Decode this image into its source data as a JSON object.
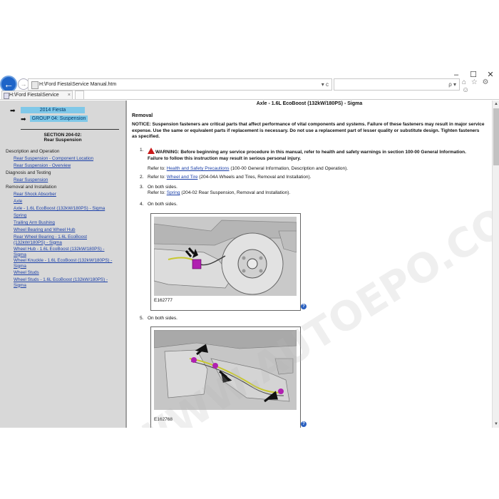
{
  "window": {
    "min": "–",
    "max": "☐",
    "close": "✕"
  },
  "address": {
    "url": "H:\\Ford Fiesta\\Service Manual.htm",
    "tools": "▾ c"
  },
  "search": {
    "tools": "ρ ▾"
  },
  "right_icons": "⌂ ☆ ⚙ ☺",
  "tab": {
    "label": "H:\\Ford Fiesta\\Service Man...",
    "close": "×"
  },
  "sidebar": {
    "year_pill": "2014 Fiesta",
    "group_pill": "GROUP 04: Suspension",
    "section_line1": "SECTION 204-02:",
    "section_line2": "Rear Suspension",
    "categories": [
      {
        "label": "Description and Operation"
      },
      {
        "label": "Diagnosis and Testing"
      },
      {
        "label": "Removal and Installation"
      }
    ],
    "links": [
      "Rear Suspension - Component Location",
      "Rear Suspension - Overview",
      "Rear Suspension",
      "Rear Shock Absorber",
      "Axle",
      "Axle - 1.6L EcoBoost (132kW/180PS) - Sigma",
      "Spring",
      "Trailing Arm Bushing",
      "Wheel Bearing and Wheel Hub",
      "Rear Wheel Bearing - 1.6L EcoBoost (132kW/180PS) - Sigma",
      "Wheel Hub - 1.6L EcoBoost (132kW/180PS) - Sigma",
      "Wheel Knuckle - 1.6L EcoBoost (132kW/180PS) - Sigma",
      "Wheel Studs",
      "Wheel Studs - 1.6L EcoBoost (132kW/180PS) - Sigma"
    ]
  },
  "doc": {
    "title": "Axle - 1.6L EcoBoost (132kW/180PS) - Sigma",
    "heading": "Removal",
    "notice": "NOTICE: Suspension fasteners are critical parts that affect performance of vital components and systems. Failure of these fasteners may result in major service expense. Use the same or equivalent parts if replacement is necessary. Do not use a replacement part of lesser quality or substitute design. Tighten fasteners as specified.",
    "steps": [
      {
        "num": "1.",
        "warning": "WARNING: Before beginning any service procedure in this manual, refer to health and safety warnings in section 100-00 General Information. Failure to follow this instruction may result in serious personal injury.",
        "refer_prefix": "Refer to: ",
        "refer_link": "Health and Safety Precautions",
        "refer_suffix": " (100-00 General Information, Description and Operation)."
      },
      {
        "num": "2.",
        "refer_prefix": "Refer to: ",
        "refer_link": "Wheel and Tire",
        "refer_suffix": " (204-04A Wheels and Tires, Removal and Installation)."
      },
      {
        "num": "3.",
        "text": "On both sides.",
        "refer_prefix": "Refer to: ",
        "refer_link": "Spring",
        "refer_suffix": " (204-02 Rear Suspension, Removal and Installation)."
      },
      {
        "num": "4.",
        "text": "On both sides."
      },
      {
        "num": "5.",
        "text": "On both sides."
      }
    ],
    "figures": [
      {
        "label": "E162777",
        "help": "?"
      },
      {
        "label": "E162768",
        "help": "?"
      }
    ]
  },
  "watermark": "WWW.AUTOEPO.COM",
  "colors": {
    "pill_bg": "#80c8e8",
    "link": "#1a3fa8",
    "sidebar_bg": "#d8d8d8",
    "warning": "#c81818",
    "accent_arrow": "#1e64c8"
  }
}
